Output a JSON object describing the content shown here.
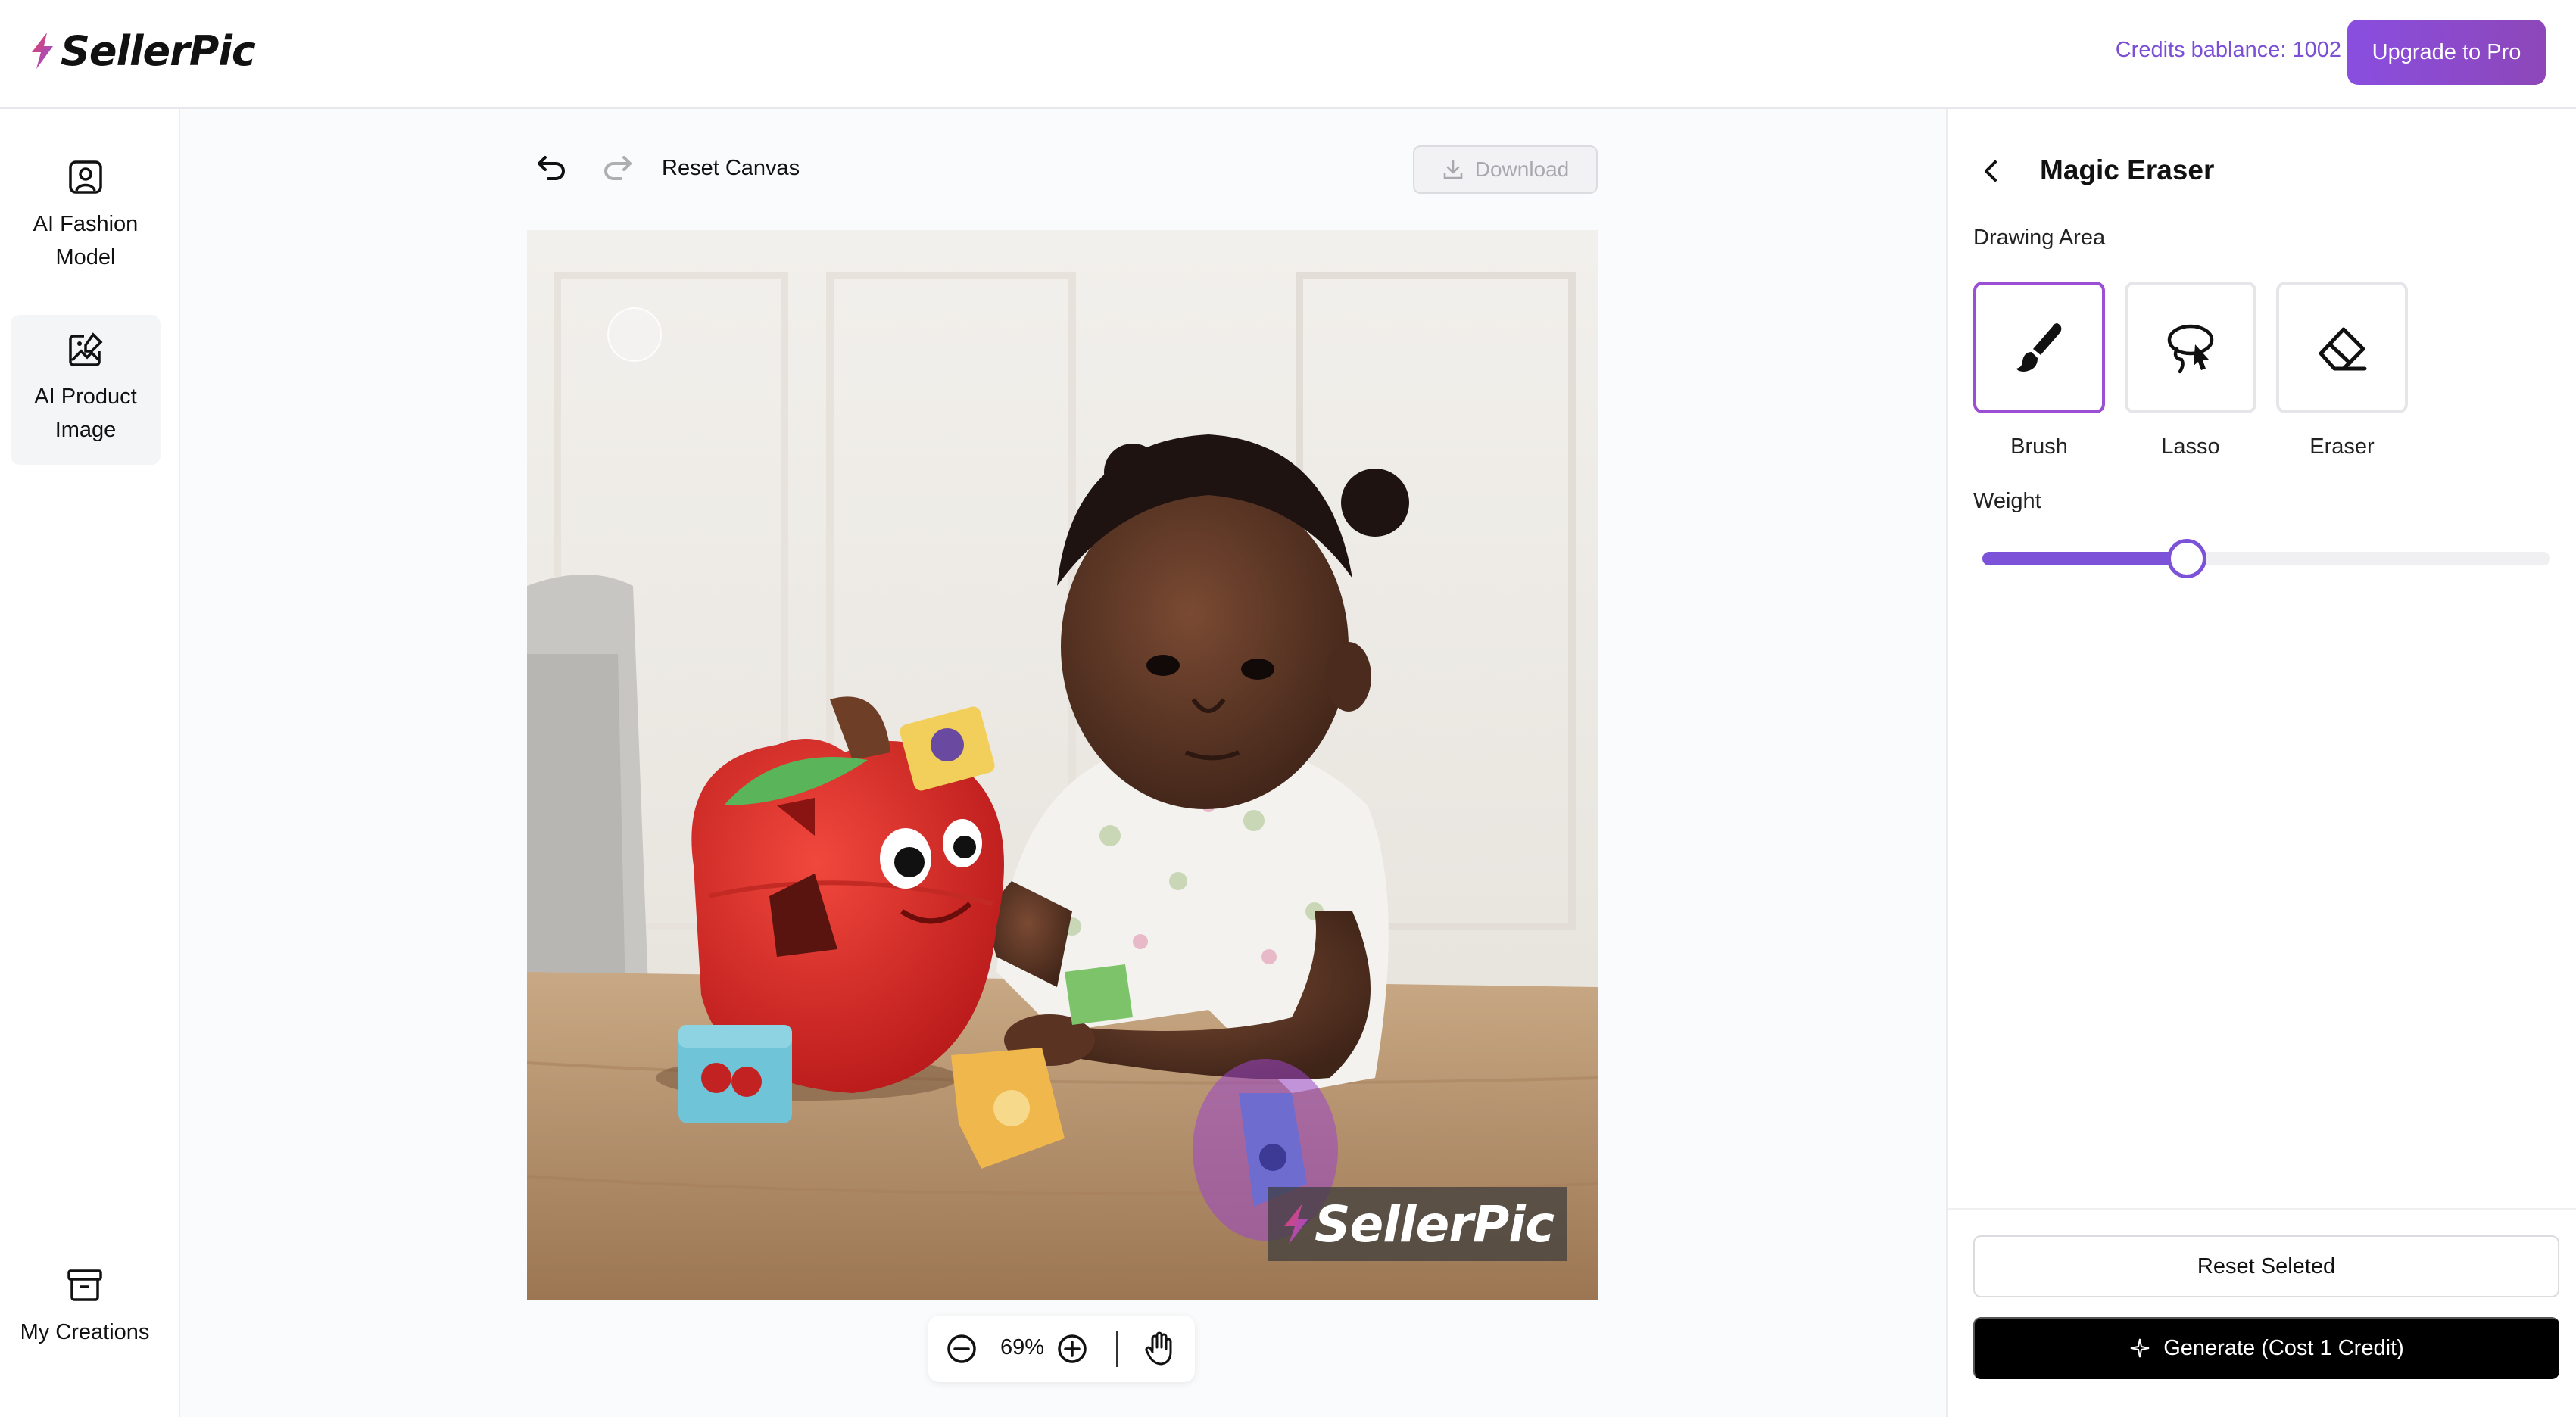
{
  "header": {
    "logo_text": "SellerPic",
    "credits_text": "Credits bablance: 1002",
    "upgrade_label": "Upgrade to Pro"
  },
  "sidebar": {
    "items": [
      {
        "label": "AI Fashion Model",
        "icon": "portrait-icon",
        "active": false
      },
      {
        "label": "AI Product Image",
        "icon": "image-edit-icon",
        "active": true
      },
      {
        "label": "My Creations",
        "icon": "archive-icon",
        "active": false
      }
    ]
  },
  "canvas_toolbar": {
    "undo_icon": "undo-icon",
    "redo_icon": "redo-icon",
    "reset_label": "Reset Canvas",
    "download_label": "Download",
    "download_enabled": false
  },
  "canvas": {
    "image_description_icon": "product-photo",
    "watermark_text": "SellerPic",
    "zoom_level": "69%"
  },
  "panel": {
    "title": "Magic Eraser",
    "drawing_area_label": "Drawing Area",
    "tools": [
      {
        "label": "Brush",
        "icon": "brush-icon",
        "selected": true
      },
      {
        "label": "Lasso",
        "icon": "lasso-icon",
        "selected": false
      },
      {
        "label": "Eraser",
        "icon": "eraser-icon",
        "selected": false
      }
    ],
    "weight_label": "Weight",
    "weight_value": 0.36,
    "reset_selected_label": "Reset Seleted",
    "generate_label": "Generate (Cost 1 Credit)"
  },
  "colors": {
    "accent": "#7c52d8",
    "brand_gradient": [
      "#8a4ee0",
      "#8d47b8"
    ],
    "selected_tool_border": "#9b4fd2"
  }
}
